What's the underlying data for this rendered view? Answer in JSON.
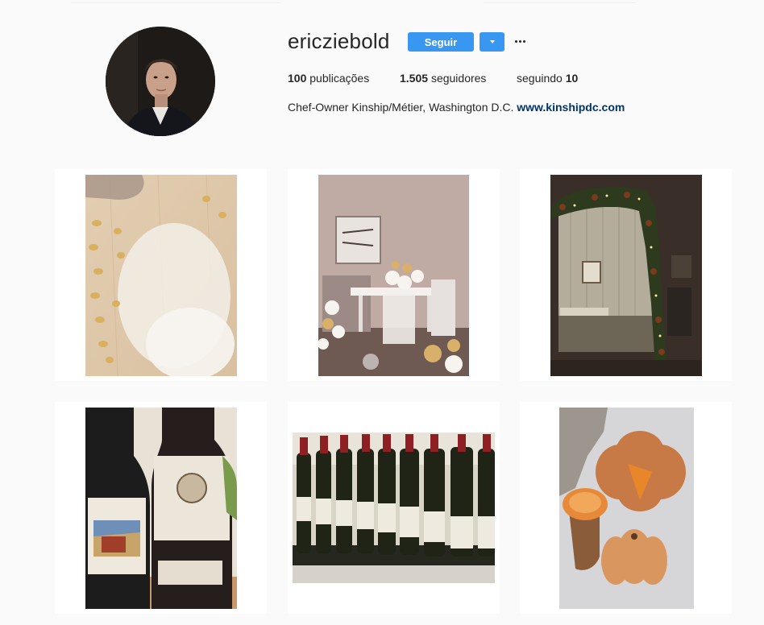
{
  "profile": {
    "username": "ericziebold",
    "follow_label": "Seguir",
    "dropdown_icon": "chevron-down-icon",
    "more_icon": "ellipsis-icon",
    "accent_color": "#3897f0",
    "stats": {
      "posts_count": "100",
      "posts_label": "publicações",
      "followers_count": "1.505",
      "followers_label": "seguidores",
      "following_label": "seguindo",
      "following_count": "10"
    },
    "bio": {
      "text": "Chef-Owner Kinship/Métier, Washington D.C.",
      "link": "www.kinshipdc.com"
    }
  },
  "posts": [
    {
      "subject": "pasta-and-flour"
    },
    {
      "subject": "dining-room-with-balloons"
    },
    {
      "subject": "holiday-garland-archway"
    },
    {
      "subject": "wine-bottles-pair"
    },
    {
      "subject": "wine-bottles-row"
    },
    {
      "subject": "pumpkins-and-squash"
    }
  ]
}
